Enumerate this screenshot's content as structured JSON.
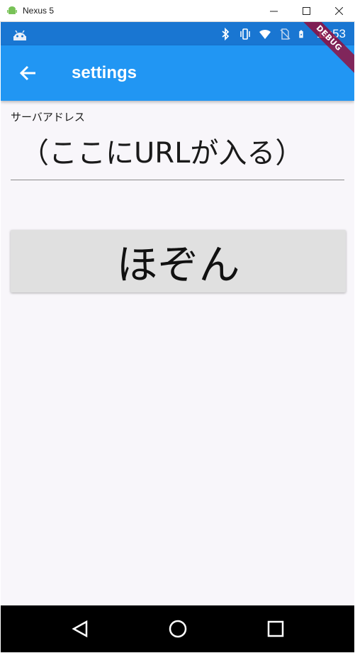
{
  "window": {
    "title": "Nexus 5",
    "controls": [
      "minimize",
      "maximize",
      "close"
    ]
  },
  "status_bar": {
    "time": "11:53",
    "icons": [
      "android-icon",
      "bluetooth-icon",
      "vibrate-icon",
      "wifi-icon",
      "no-sim-icon",
      "battery-icon"
    ]
  },
  "app_bar": {
    "title": "settings",
    "back_icon": "arrow-back-icon",
    "color": "#2196f3"
  },
  "debug_banner": "DEBUG",
  "form": {
    "server_label": "サーバアドレス",
    "server_placeholder": "（ここにURLが入る）",
    "save_label": "ほぞん"
  },
  "nav_bar": {
    "buttons": [
      "back-triangle-icon",
      "home-circle-icon",
      "recents-square-icon"
    ]
  },
  "colors": {
    "status_bar": "#1976d2",
    "app_bar": "#2196f3",
    "background": "#f8f6fa",
    "button": "#e0e0e0"
  }
}
